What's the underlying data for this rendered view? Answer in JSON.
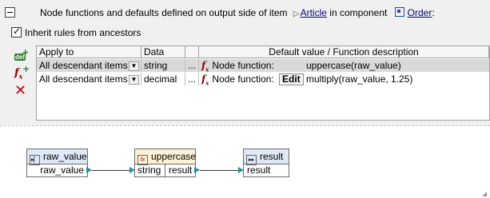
{
  "header": {
    "text": "Node functions and defaults defined on output side of item",
    "item_link": "Article",
    "mid_text": "in component",
    "component_link": "Order",
    "tail": ":"
  },
  "inherit": {
    "label": "Inherit rules from ancestors",
    "checked": true
  },
  "toolbar": {
    "add_icon": "add-default-icon",
    "add_fn_icon": "add-function-icon",
    "delete_icon": "delete-icon"
  },
  "grid": {
    "headers": [
      "Apply to",
      "Data type",
      "Default value / Function description"
    ],
    "rows": [
      {
        "apply_to": "All descendant items",
        "data_type": "string",
        "dots": "...",
        "kind": "Node function:",
        "edit": "",
        "value": "uppercase(raw_value)"
      },
      {
        "apply_to": "All descendant items",
        "data_type": "decimal",
        "dots": "...",
        "kind": "Node function:",
        "edit": "Edit",
        "value": "multiply(raw_value, 1.25)"
      }
    ]
  },
  "mapping": {
    "input_node": {
      "title": "raw_value",
      "port": "raw_value"
    },
    "function_node": {
      "title": "uppercase",
      "in_port": "string",
      "out_port": "result"
    },
    "output_node": {
      "title": "result",
      "port": "result"
    }
  }
}
